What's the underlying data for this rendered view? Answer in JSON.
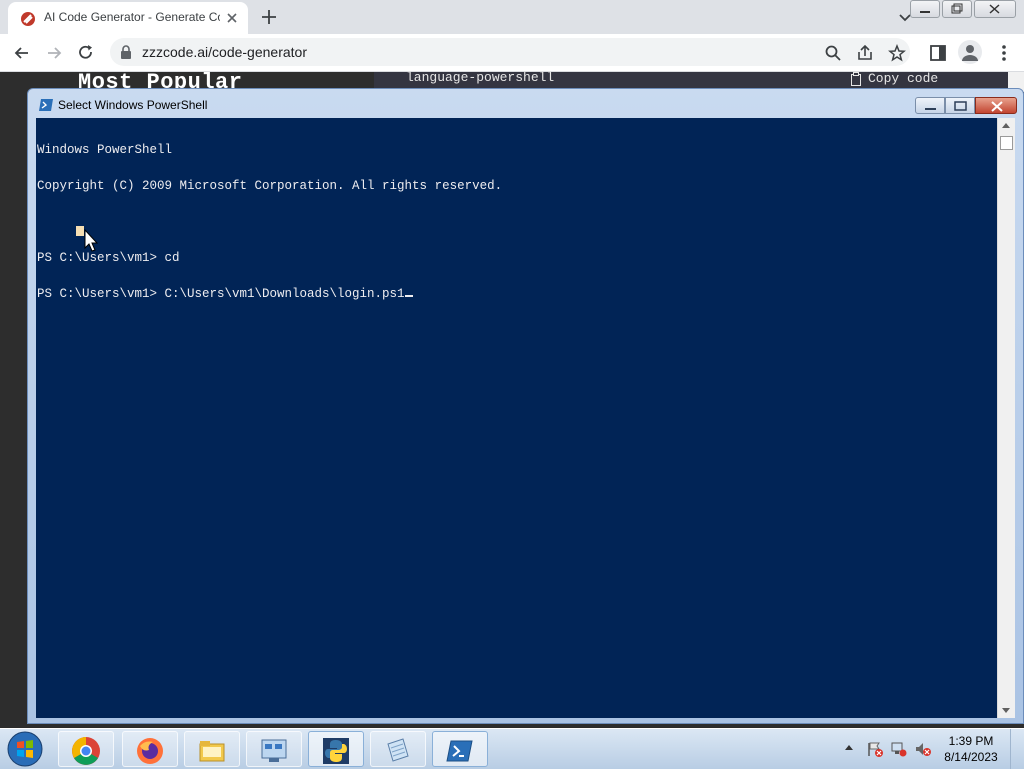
{
  "browser": {
    "tab_title": "AI Code Generator - Generate Co",
    "url": "zzzcode.ai/code-generator"
  },
  "page": {
    "heading": "Most Popular",
    "code_lang": "language-powershell",
    "copy_label": "Copy code"
  },
  "powershell": {
    "title": "Select Windows PowerShell",
    "lines": [
      "Windows PowerShell",
      "Copyright (C) 2009 Microsoft Corporation. All rights reserved.",
      "",
      "PS C:\\Users\\vm1> cd",
      "PS C:\\Users\\vm1> C:\\Users\\vm1\\Downloads\\login.ps1"
    ],
    "background_color": "#012456",
    "text_color": "#eeedf0"
  },
  "taskbar": {
    "apps": [
      "chrome-icon",
      "firefox-icon",
      "file-explorer-icon",
      "control-panel-icon",
      "python-icon",
      "notepad-icon",
      "powershell-icon"
    ],
    "time": "1:39 PM",
    "date": "8/14/2023"
  }
}
